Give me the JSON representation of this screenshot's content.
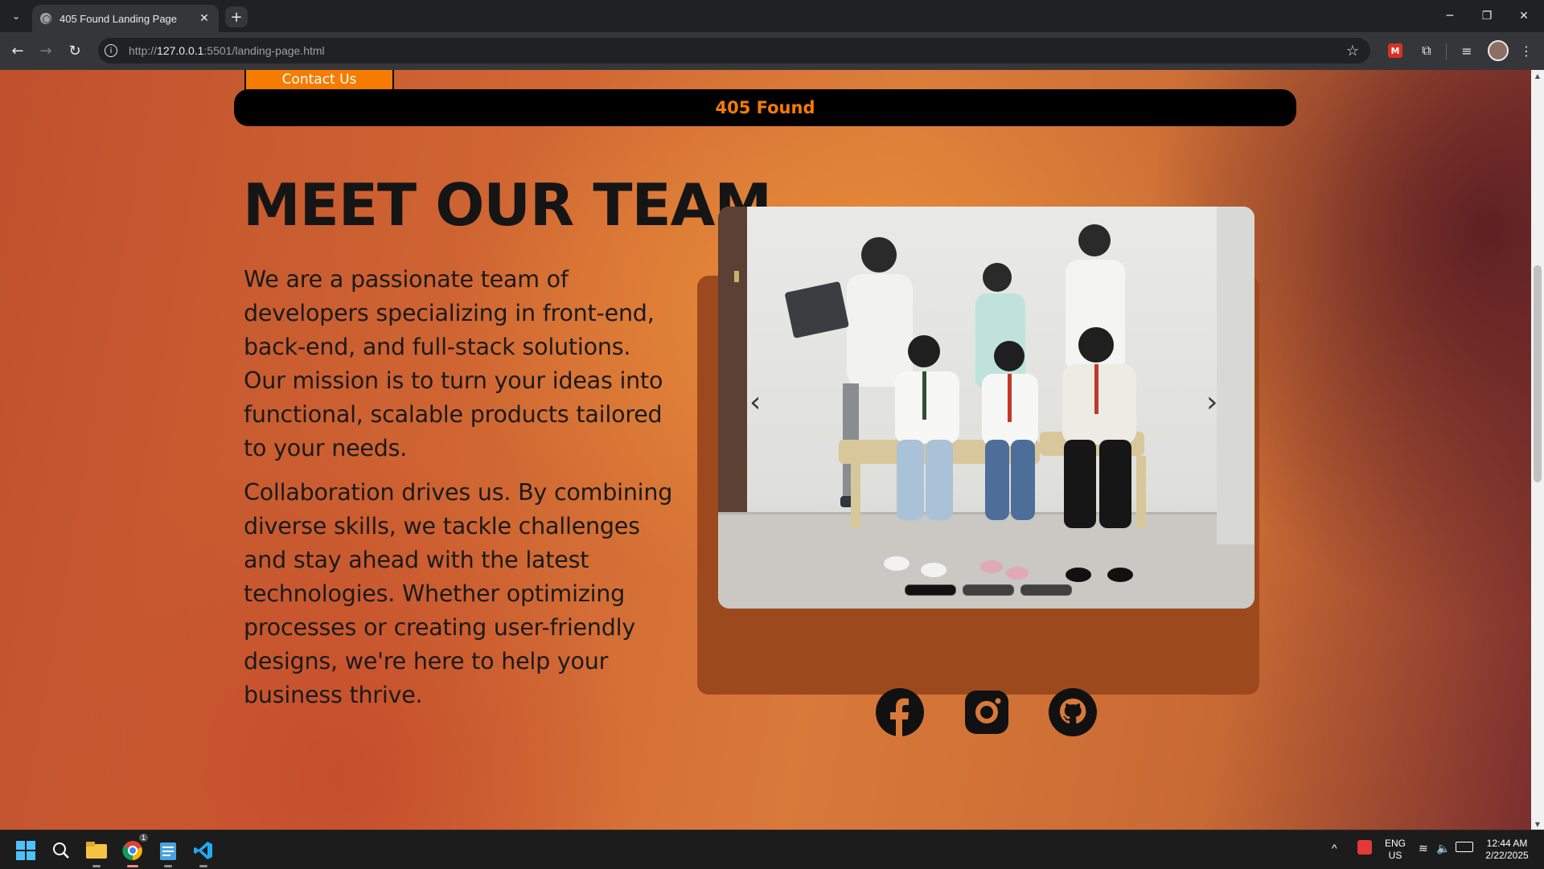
{
  "browser": {
    "tab_title": "405 Found Landing Page",
    "url_prefix": "http://",
    "url_host": "127.0.0.1",
    "url_path": ":5501/landing-page.html",
    "new_tab": "+"
  },
  "page": {
    "contact_label": "Contact Us",
    "brand": "405 Found",
    "heading": "MEET OUR TEAM",
    "paragraph1": "We are a passionate team of developers specializing in front-end, back-end, and full-stack solutions. Our mission is to turn your ideas into functional, scalable products tailored to your needs.",
    "paragraph2": "Collaboration drives us. By combining diverse skills, we tackle challenges and stay ahead with the latest technologies. Whether optimizing processes or creating user-friendly designs, we're here to help your business thrive.",
    "carousel": {
      "slides": 3,
      "active_index": 0
    },
    "socials": [
      "facebook-icon",
      "instagram-icon",
      "github-icon"
    ]
  },
  "taskbar": {
    "lang_top": "ENG",
    "lang_bottom": "US",
    "time": "12:44 AM",
    "date": "2/22/2025",
    "chrome_badge": "1"
  },
  "colors": {
    "accent": "#f57c00",
    "brand_bar": "#000000"
  }
}
